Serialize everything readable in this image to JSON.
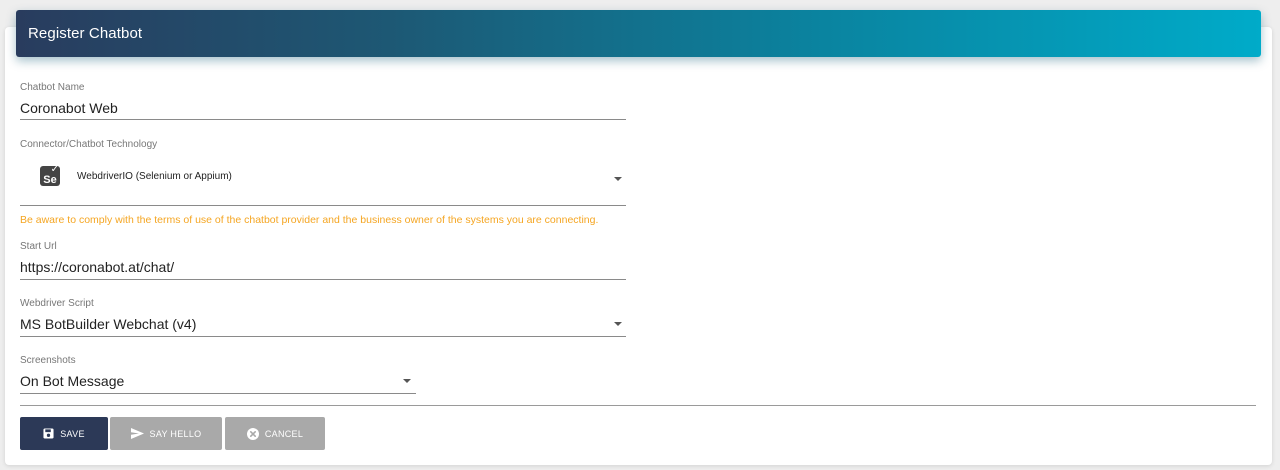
{
  "header": {
    "title": "Register Chatbot"
  },
  "form": {
    "chatbot_name": {
      "label": "Chatbot Name",
      "value": "Coronabot Web"
    },
    "connector": {
      "label": "Connector/Chatbot Technology",
      "value": "WebdriverIO (Selenium or Appium)",
      "icon": "selenium-icon",
      "icon_text": "Se"
    },
    "warning": "Be aware to comply with the terms of use of the chatbot provider and the business owner of the systems you are connecting.",
    "start_url": {
      "label": "Start Url",
      "value": "https://coronabot.at/chat/"
    },
    "webdriver_script": {
      "label": "Webdriver Script",
      "value": "MS BotBuilder Webchat (v4)"
    },
    "screenshots": {
      "label": "Screenshots",
      "value": "On Bot Message"
    }
  },
  "buttons": {
    "save": "SAVE",
    "say_hello": "SAY HELLO",
    "cancel": "CANCEL"
  },
  "colors": {
    "header_gradient_start": "#293c5e",
    "header_gradient_end": "#00abc9",
    "primary_button": "#2c3957",
    "disabled_button": "#a9a9a9",
    "warning_text": "#f5a623"
  }
}
